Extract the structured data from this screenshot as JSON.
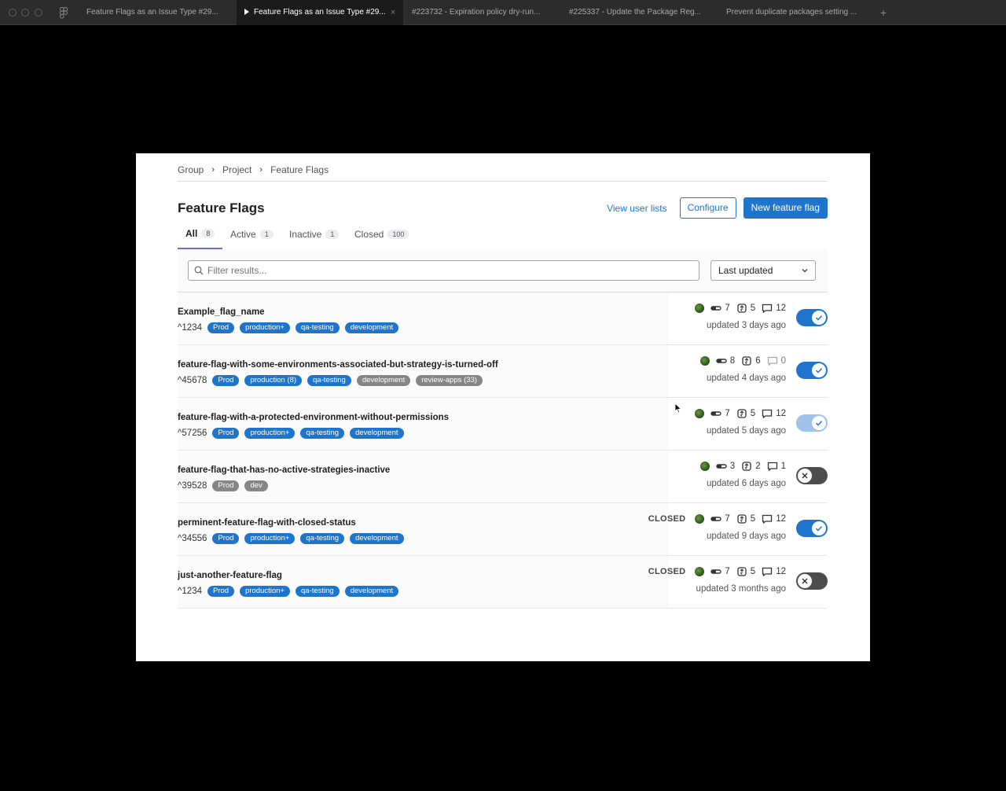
{
  "browser": {
    "tabs": [
      {
        "label": "Feature Flags as an Issue Type #29...",
        "active": false
      },
      {
        "label": "Feature Flags as an Issue Type #29...",
        "active": true
      },
      {
        "label": "#223732 - Expiration policy dry-run...",
        "active": false
      },
      {
        "label": "#225337 - Update the Package Reg...",
        "active": false
      },
      {
        "label": "Prevent duplicate packages setting ...",
        "active": false
      }
    ],
    "close_glyph": "×",
    "add_glyph": "+"
  },
  "breadcrumb": [
    "Group",
    "Project",
    "Feature Flags"
  ],
  "breadcrumb_sep": "›",
  "page": {
    "title": "Feature Flags",
    "view_user_lists": "View user lists",
    "configure": "Configure",
    "new_flag": "New feature flag"
  },
  "filter_tabs": [
    {
      "label": "All",
      "count": "8",
      "active": true
    },
    {
      "label": "Active",
      "count": "1",
      "active": false
    },
    {
      "label": "Inactive",
      "count": "1",
      "active": false
    },
    {
      "label": "Closed",
      "count": "100",
      "active": false
    }
  ],
  "search": {
    "placeholder": "Filter results..."
  },
  "sort": {
    "selected": "Last updated"
  },
  "colors": {
    "accent": "#1f75cb",
    "gray_badge": "#868686",
    "toggle_off": "#4d4d4d",
    "toggle_disabled": "#9ec2e8"
  },
  "flags": [
    {
      "name": "Example_flag_name",
      "id": "^1234",
      "envs": [
        {
          "label": "Prod",
          "gray": false
        },
        {
          "label": "production+",
          "gray": false
        },
        {
          "label": "qa-testing",
          "gray": false
        },
        {
          "label": "development",
          "gray": false
        }
      ],
      "status": "",
      "links": "7",
      "issues": "5",
      "comments": "12",
      "comments_empty": false,
      "updated": "updated 3 days ago",
      "toggle": "on",
      "toggle_disabled": false
    },
    {
      "name": "feature-flag-with-some-environments-associated-but-strategy-is-turned-off",
      "id": "^45678",
      "envs": [
        {
          "label": "Prod",
          "gray": false
        },
        {
          "label": "production (8)",
          "gray": false
        },
        {
          "label": "qa-testing",
          "gray": false
        },
        {
          "label": "development",
          "gray": true
        },
        {
          "label": "review-apps (33)",
          "gray": true
        }
      ],
      "status": "",
      "links": "8",
      "issues": "6",
      "comments": "0",
      "comments_empty": true,
      "updated": "updated 4 days ago",
      "toggle": "on",
      "toggle_disabled": false
    },
    {
      "name": "feature-flag-with-a-protected-environment-without-permissions",
      "id": "^57256",
      "envs": [
        {
          "label": "Prod",
          "gray": false
        },
        {
          "label": "production+",
          "gray": false
        },
        {
          "label": "qa-testing",
          "gray": false
        },
        {
          "label": "development",
          "gray": false
        }
      ],
      "status": "",
      "links": "7",
      "issues": "5",
      "comments": "12",
      "comments_empty": false,
      "updated": "updated 5 days ago",
      "toggle": "on",
      "toggle_disabled": true
    },
    {
      "name": "feature-flag-that-has-no-active-strategies-inactive",
      "id": "^39528",
      "envs": [
        {
          "label": "Prod",
          "gray": true
        },
        {
          "label": "dev",
          "gray": true
        }
      ],
      "status": "",
      "links": "3",
      "issues": "2",
      "comments": "1",
      "comments_empty": false,
      "updated": "updated 6 days ago",
      "toggle": "off",
      "toggle_disabled": false
    },
    {
      "name": "perminent-feature-flag-with-closed-status",
      "id": "^34556",
      "envs": [
        {
          "label": "Prod",
          "gray": false
        },
        {
          "label": "production+",
          "gray": false
        },
        {
          "label": "qa-testing",
          "gray": false
        },
        {
          "label": "development",
          "gray": false
        }
      ],
      "status": "CLOSED",
      "links": "7",
      "issues": "5",
      "comments": "12",
      "comments_empty": false,
      "updated": "updated 9 days ago",
      "toggle": "on",
      "toggle_disabled": false
    },
    {
      "name": "just-another-feature-flag",
      "id": "^1234",
      "envs": [
        {
          "label": "Prod",
          "gray": false
        },
        {
          "label": "production+",
          "gray": false
        },
        {
          "label": "qa-testing",
          "gray": false
        },
        {
          "label": "development",
          "gray": false
        }
      ],
      "status": "CLOSED",
      "links": "7",
      "issues": "5",
      "comments": "12",
      "comments_empty": false,
      "updated": "updated 3 months ago",
      "toggle": "off",
      "toggle_disabled": false
    }
  ]
}
